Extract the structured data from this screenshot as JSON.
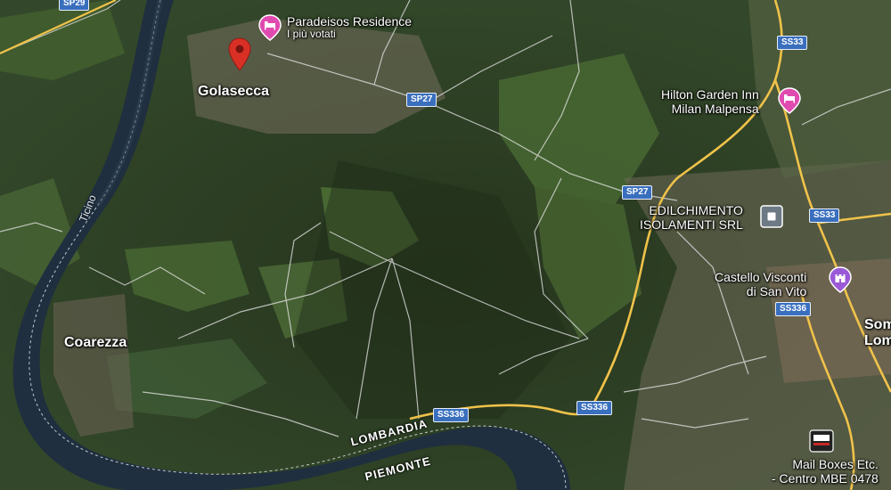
{
  "places": {
    "golasecca": "Golasecca",
    "coarezza": "Coarezza",
    "somma_lombardo_line1": "Som",
    "somma_lombardo_line2": "Lomb"
  },
  "pois": {
    "paradeisos_name": "Paradeisos Residence",
    "paradeisos_sub": "I più votati",
    "hilton_line1": "Hilton Garden Inn",
    "hilton_line2": "Milan Malpensa",
    "edilchimento_line1": "EDILCHIMENTO",
    "edilchimento_line2": "ISOLAMENTI SRL",
    "castello_line1": "Castello Visconti",
    "castello_line2": "di San Vito",
    "mailboxes_line1": "Mail Boxes Etc.",
    "mailboxes_line2": "- Centro MBE 0478"
  },
  "roads": {
    "sp29": "SP29",
    "sp27_a": "SP27",
    "sp27_b": "SP27",
    "ss33_a": "SS33",
    "ss33_b": "SS33",
    "ss336_a": "SS336",
    "ss336_b": "SS336",
    "ss336_c": "SS336"
  },
  "regions": {
    "lombardia": "LOMBARDIA",
    "piemonte": "PIEMONTE"
  },
  "water": {
    "ticino": "Ticino"
  },
  "icons": {
    "hotel": "hotel-bed-icon",
    "castle": "castle-icon",
    "pin": "location-pin-icon",
    "business": "square-dot-icon"
  },
  "colors": {
    "hotel_pin": "#e04bb0",
    "castle_pin": "#9a59d6",
    "selected_pin": "#d93025",
    "road_major": "#f0c24a",
    "shield": "#3a6fbe"
  }
}
